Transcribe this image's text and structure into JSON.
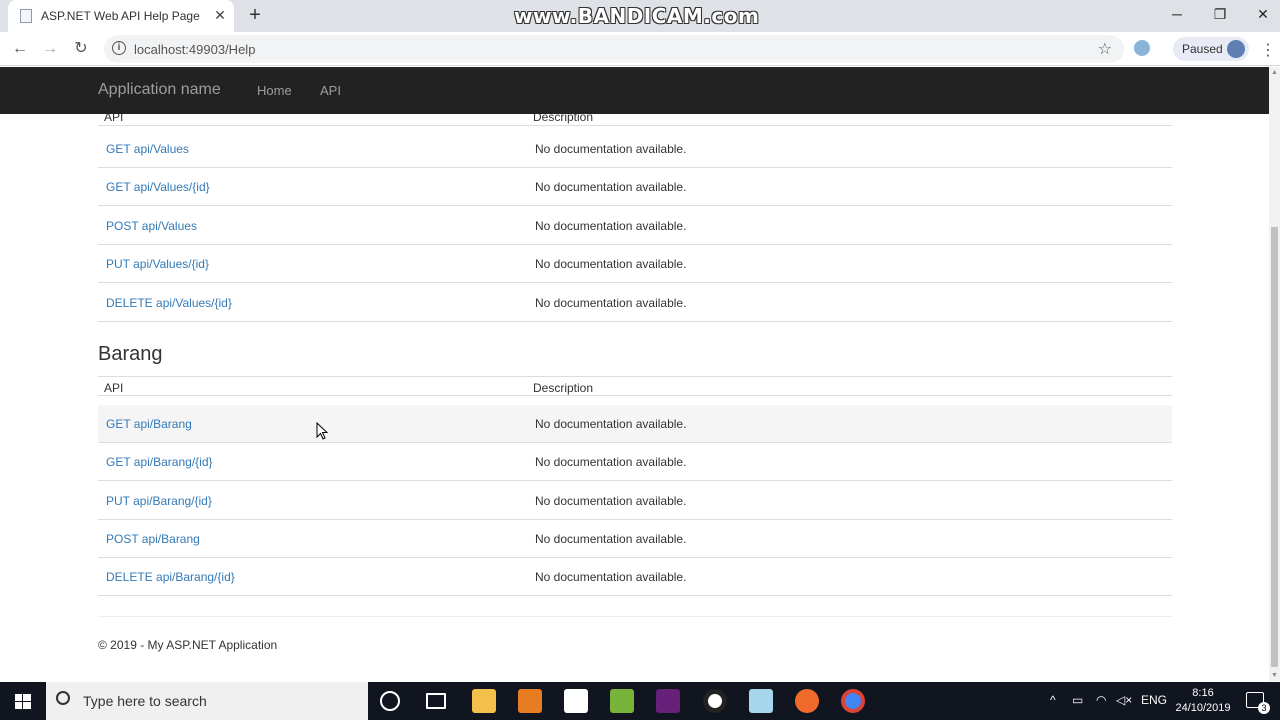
{
  "browser": {
    "tab_title": "ASP.NET Web API Help Page",
    "url": "localhost:49903/Help",
    "profile_status": "Paused"
  },
  "watermark": "www.BANDICAM.com",
  "navbar": {
    "brand": "Application name",
    "links": [
      "Home",
      "API"
    ]
  },
  "table_headers": {
    "api": "API",
    "description": "Description"
  },
  "values_rows": [
    {
      "api": "GET api/Values",
      "desc": "No documentation available."
    },
    {
      "api": "GET api/Values/{id}",
      "desc": "No documentation available."
    },
    {
      "api": "POST api/Values",
      "desc": "No documentation available."
    },
    {
      "api": "PUT api/Values/{id}",
      "desc": "No documentation available."
    },
    {
      "api": "DELETE api/Values/{id}",
      "desc": "No documentation available."
    }
  ],
  "barang": {
    "title": "Barang",
    "rows": [
      {
        "api": "GET api/Barang",
        "desc": "No documentation available."
      },
      {
        "api": "GET api/Barang/{id}",
        "desc": "No documentation available."
      },
      {
        "api": "PUT api/Barang/{id}",
        "desc": "No documentation available."
      },
      {
        "api": "POST api/Barang",
        "desc": "No documentation available."
      },
      {
        "api": "DELETE api/Barang/{id}",
        "desc": "No documentation available."
      }
    ]
  },
  "footer": "© 2019 - My ASP.NET Application",
  "taskbar": {
    "search_placeholder": "Type here to search",
    "language": "ENG",
    "time": "8:16",
    "date": "24/10/2019",
    "notification_count": "3"
  },
  "colors": {
    "link": "#337ab7",
    "navbar": "#222222",
    "taskbar": "#101520"
  }
}
